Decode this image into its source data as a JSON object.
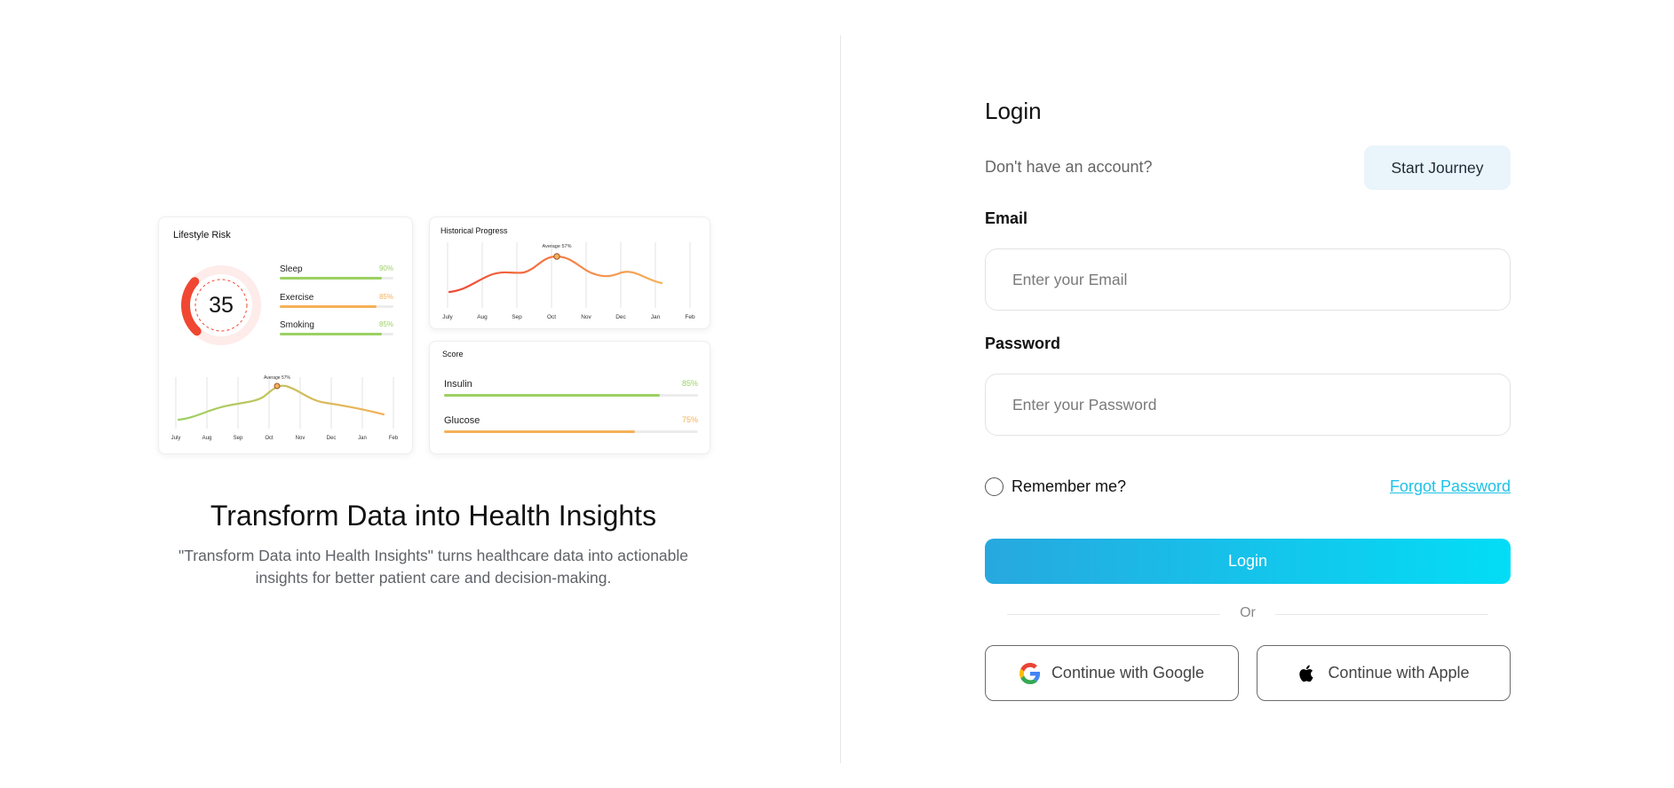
{
  "colors": {
    "accent": "#1fc2e6",
    "login_gradient_start": "#27a8df",
    "login_gradient_end": "#03ddf6",
    "green": "#9bd162",
    "orange": "#f4b159",
    "red": "#f04732"
  },
  "lifestyle": {
    "title": "Lifestyle Risk",
    "score": "35",
    "metrics": [
      {
        "name": "Sleep",
        "pct": "90%",
        "value": 0.9,
        "color": "#9bd162"
      },
      {
        "name": "Exercise",
        "pct": "85%",
        "value": 0.85,
        "color": "#f4b159"
      },
      {
        "name": "Smoking",
        "pct": "85%",
        "value": 0.9,
        "color": "#9bd162"
      }
    ],
    "chart_label": "Average 57%",
    "months": [
      "July",
      "Aug",
      "Sep",
      "Oct",
      "Nov",
      "Dec",
      "Jan",
      "Feb"
    ]
  },
  "historical": {
    "title": "Historical Progress",
    "chart_label": "Average 57%",
    "months": [
      "July",
      "Aug",
      "Sep",
      "Oct",
      "Nov",
      "Dec",
      "Jan",
      "Feb"
    ]
  },
  "score": {
    "title": "Score",
    "rows": [
      {
        "name": "Insulin",
        "pct": "85%",
        "value": 0.85,
        "color": "#9bd162"
      },
      {
        "name": "Glucose",
        "pct": "75%",
        "value": 0.75,
        "color": "#f4b159"
      }
    ]
  },
  "hero": {
    "title": "Transform Data into Health Insights",
    "description": "\"Transform Data into Health Insights\" turns healthcare data into actionable insights for better patient care and decision-making."
  },
  "login": {
    "title": "Login",
    "no_account": "Don't have an account?",
    "start_journey": "Start Journey",
    "email_label": "Email",
    "email_placeholder": "Enter your Email",
    "password_label": "Password",
    "password_placeholder": "Enter your Password",
    "remember": "Remember me?",
    "forgot": "Forgot Password",
    "submit": "Login",
    "or": "Or",
    "google": "Continue with Google",
    "apple": "Continue with Apple"
  }
}
